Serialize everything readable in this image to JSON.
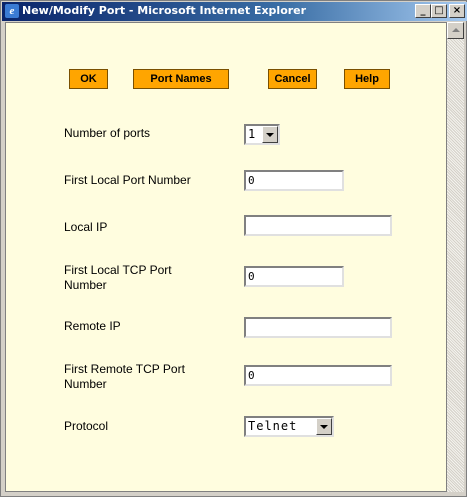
{
  "window": {
    "title": "New/Modify Port - Microsoft Internet Explorer",
    "icon": "ie-icon"
  },
  "buttons": {
    "ok": "OK",
    "port_names": "Port Names",
    "cancel": "Cancel",
    "help": "Help"
  },
  "form": {
    "number_of_ports": {
      "label": "Number of ports",
      "value": "1"
    },
    "first_local_port": {
      "label": "First Local Port Number",
      "value": "0"
    },
    "local_ip": {
      "label": "Local IP",
      "value": ""
    },
    "first_local_tcp_port": {
      "label_line1": "First Local TCP Port",
      "label_line2": "Number",
      "value": "0"
    },
    "remote_ip": {
      "label": "Remote IP",
      "value": ""
    },
    "first_remote_tcp_port": {
      "label_line1": "First Remote TCP Port",
      "label_line2": "Number",
      "value": "0"
    },
    "protocol": {
      "label": "Protocol",
      "value": "Telnet"
    }
  },
  "colors": {
    "button_bg": "#ffa500",
    "content_bg": "#fffddf",
    "titlebar": "#0a246a"
  }
}
